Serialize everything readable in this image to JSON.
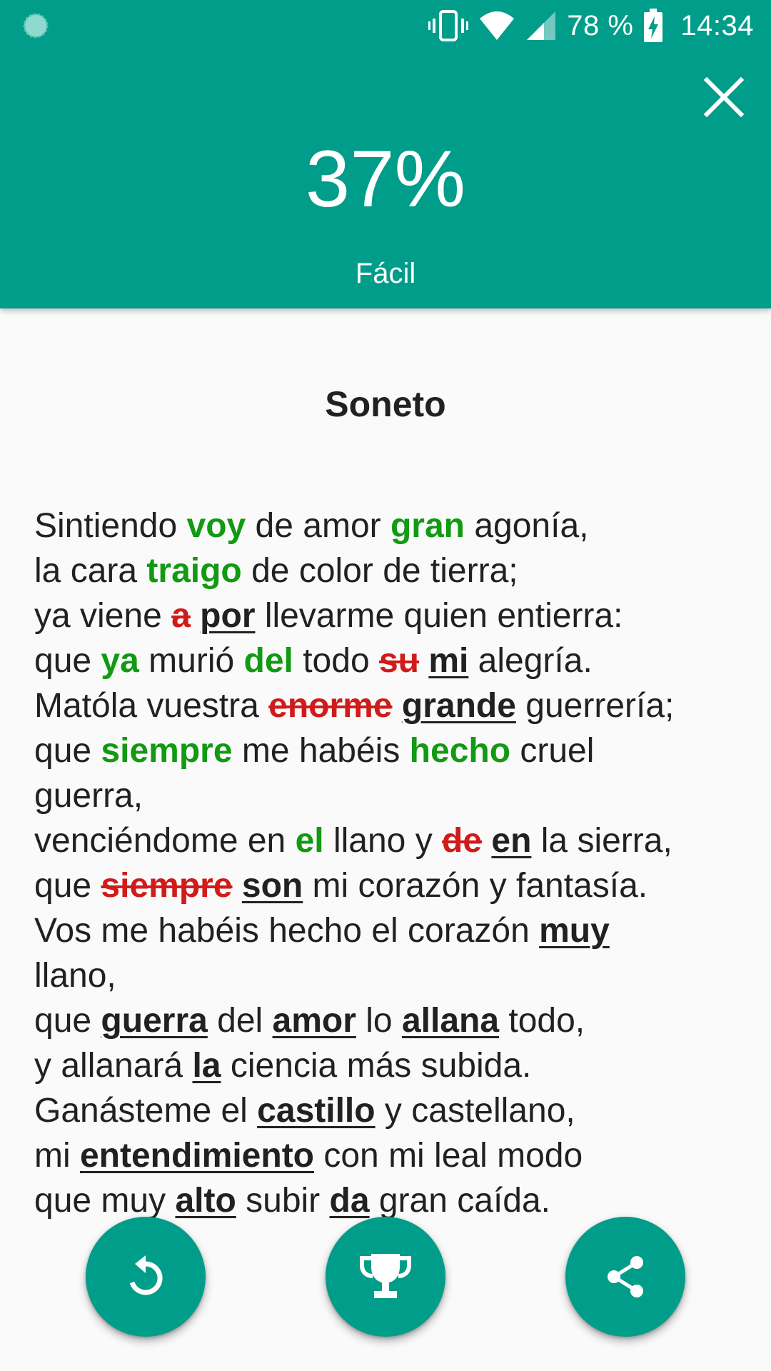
{
  "status_bar": {
    "battery": "78 %",
    "time": "14:34"
  },
  "header": {
    "score": "37%",
    "level": "Fácil"
  },
  "poem": {
    "title": "Soneto",
    "lines": [
      [
        {
          "t": "Sintiendo "
        },
        {
          "t": "voy",
          "k": "ok"
        },
        {
          "t": " de amor "
        },
        {
          "t": "gran",
          "k": "ok"
        },
        {
          "t": " agonía,"
        }
      ],
      [
        {
          "t": "la cara "
        },
        {
          "t": "traigo",
          "k": "ok"
        },
        {
          "t": " de color de tierra;"
        }
      ],
      [
        {
          "t": "ya viene "
        },
        {
          "t": "a",
          "k": "bad"
        },
        {
          "t": " "
        },
        {
          "t": "por",
          "k": "fix"
        },
        {
          "t": " llevarme quien entierra:"
        }
      ],
      [
        {
          "t": "que "
        },
        {
          "t": "ya",
          "k": "ok"
        },
        {
          "t": " murió "
        },
        {
          "t": "del",
          "k": "ok"
        },
        {
          "t": " todo "
        },
        {
          "t": "su",
          "k": "bad"
        },
        {
          "t": " "
        },
        {
          "t": "mi",
          "k": "fix"
        },
        {
          "t": " alegría."
        }
      ],
      [
        {
          "t": "Matóla vuestra "
        },
        {
          "t": "enorme",
          "k": "bad"
        },
        {
          "t": " "
        },
        {
          "t": "grande",
          "k": "fix"
        },
        {
          "t": " guerrería;"
        }
      ],
      [
        {
          "t": "que "
        },
        {
          "t": "siempre",
          "k": "ok"
        },
        {
          "t": " me habéis "
        },
        {
          "t": "hecho",
          "k": "ok"
        },
        {
          "t": " cruel"
        }
      ],
      [
        {
          "t": "guerra,"
        }
      ],
      [
        {
          "t": "venciéndome en "
        },
        {
          "t": "el",
          "k": "ok"
        },
        {
          "t": " llano y "
        },
        {
          "t": "de",
          "k": "bad"
        },
        {
          "t": " "
        },
        {
          "t": "en",
          "k": "fix"
        },
        {
          "t": " la sierra,"
        }
      ],
      [
        {
          "t": "que "
        },
        {
          "t": "siempre",
          "k": "bad"
        },
        {
          "t": " "
        },
        {
          "t": "son",
          "k": "fix"
        },
        {
          "t": " mi corazón y fantasía."
        }
      ],
      [
        {
          "t": "Vos me habéis hecho el corazón "
        },
        {
          "t": "muy",
          "k": "fix"
        }
      ],
      [
        {
          "t": "llano,"
        }
      ],
      [
        {
          "t": "que "
        },
        {
          "t": "guerra",
          "k": "fix"
        },
        {
          "t": " del "
        },
        {
          "t": "amor",
          "k": "fix"
        },
        {
          "t": " lo "
        },
        {
          "t": "allana",
          "k": "fix"
        },
        {
          "t": " todo,"
        }
      ],
      [
        {
          "t": "y allanará "
        },
        {
          "t": "la",
          "k": "fix"
        },
        {
          "t": " ciencia más subida."
        }
      ],
      [
        {
          "t": "Ganásteme el "
        },
        {
          "t": "castillo",
          "k": "fix"
        },
        {
          "t": " y castellano,"
        }
      ],
      [
        {
          "t": "mi "
        },
        {
          "t": "entendimiento",
          "k": "fix"
        },
        {
          "t": " con mi leal modo"
        }
      ],
      [
        {
          "t": "que muy "
        },
        {
          "t": "alto",
          "k": "fix"
        },
        {
          "t": " subir "
        },
        {
          "t": "da",
          "k": "fix"
        },
        {
          "t": " gran caída."
        }
      ]
    ]
  },
  "fabs": {
    "replay_icon": "replay-icon",
    "trophy_icon": "trophy-icon",
    "share_icon": "share-icon"
  },
  "colors": {
    "primary": "#009d8a",
    "correct": "#129a12",
    "wrong": "#d11b1b",
    "text": "#212121"
  }
}
